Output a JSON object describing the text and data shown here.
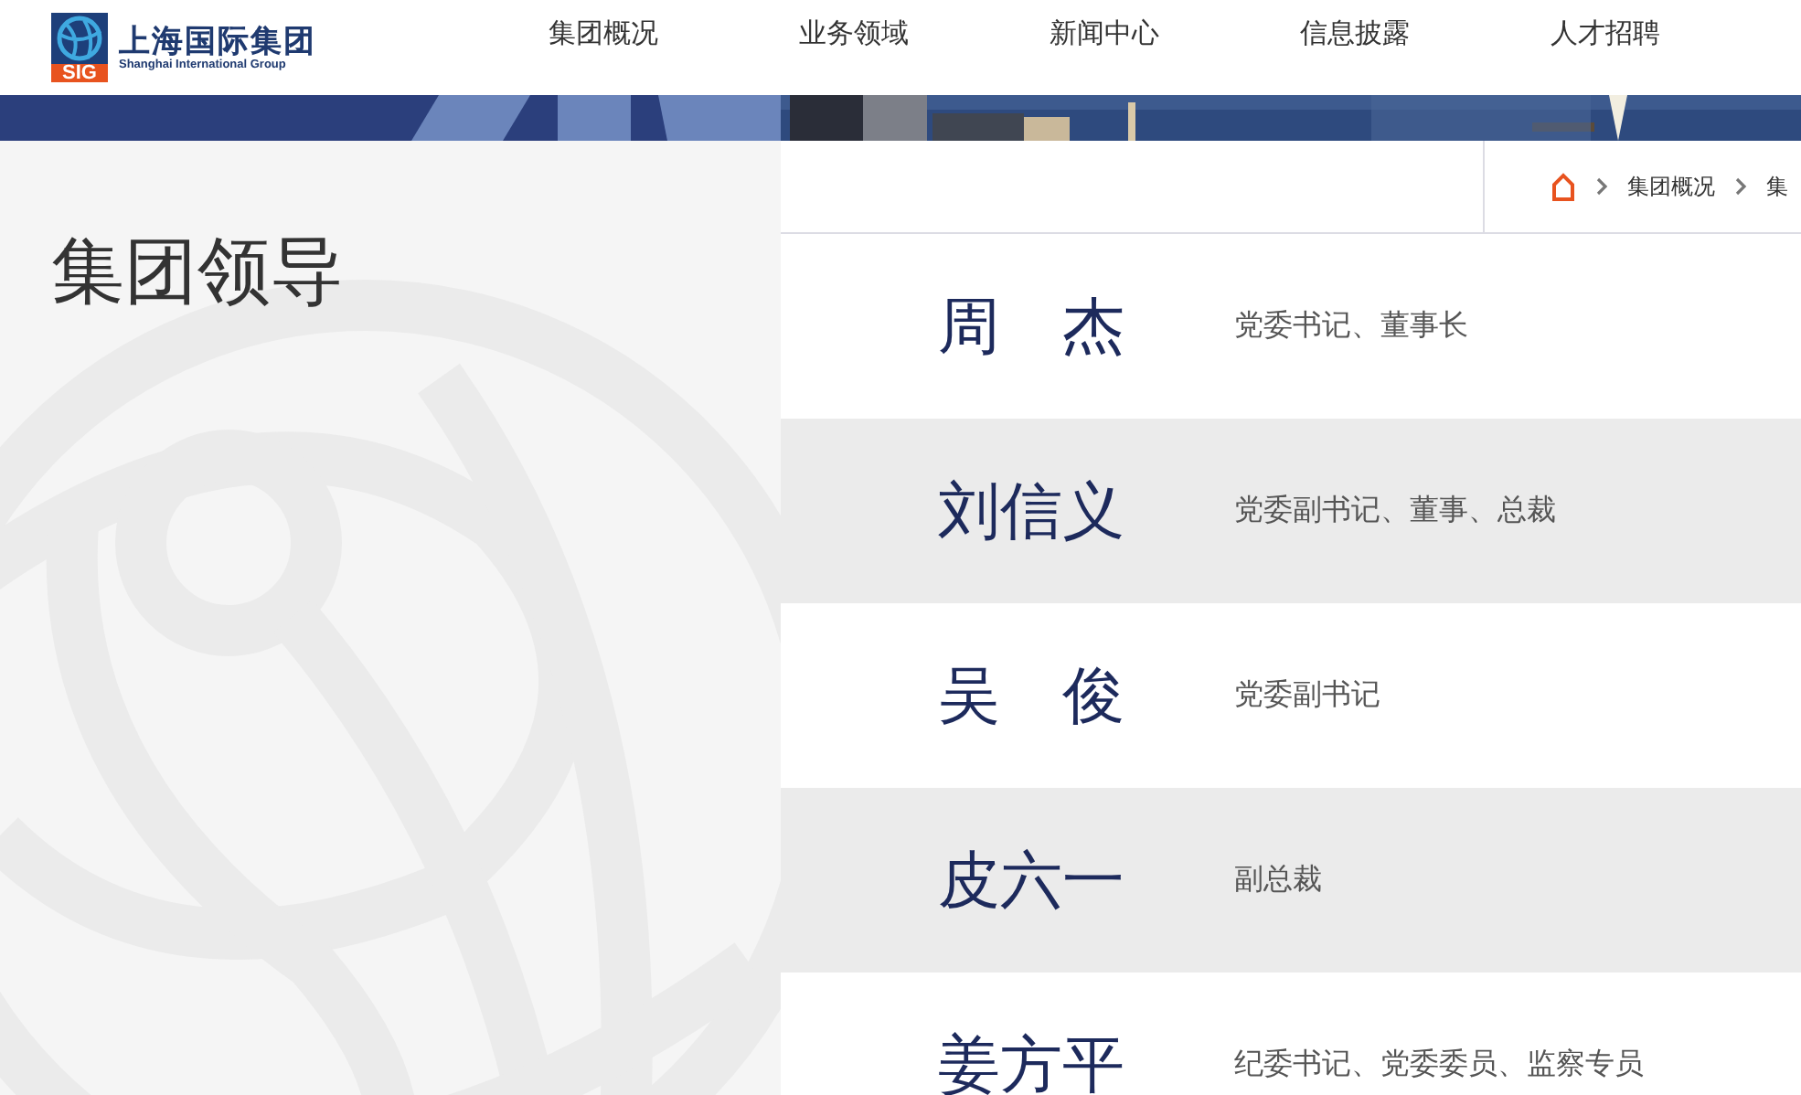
{
  "header": {
    "logo": {
      "mark": "SIG",
      "name": "上海国际集团",
      "subtitle": "Shanghai International Group"
    },
    "nav": [
      {
        "label": "集团概况"
      },
      {
        "label": "业务领域"
      },
      {
        "label": "新闻中心"
      },
      {
        "label": "信息披露"
      },
      {
        "label": "人才招聘"
      }
    ]
  },
  "sidebar": {
    "title": "集团领导"
  },
  "breadcrumb": [
    "集团概况",
    "集"
  ],
  "leaders": [
    {
      "name": "周　杰",
      "title": "党委书记、董事长"
    },
    {
      "name": "刘信义",
      "title": "党委副书记、董事、总裁"
    },
    {
      "name": "吴　俊",
      "title": "党委副书记"
    },
    {
      "name": "皮六一",
      "title": "副总裁"
    },
    {
      "name": "姜方平",
      "title": "纪委书记、党委委员、监察专员"
    }
  ]
}
